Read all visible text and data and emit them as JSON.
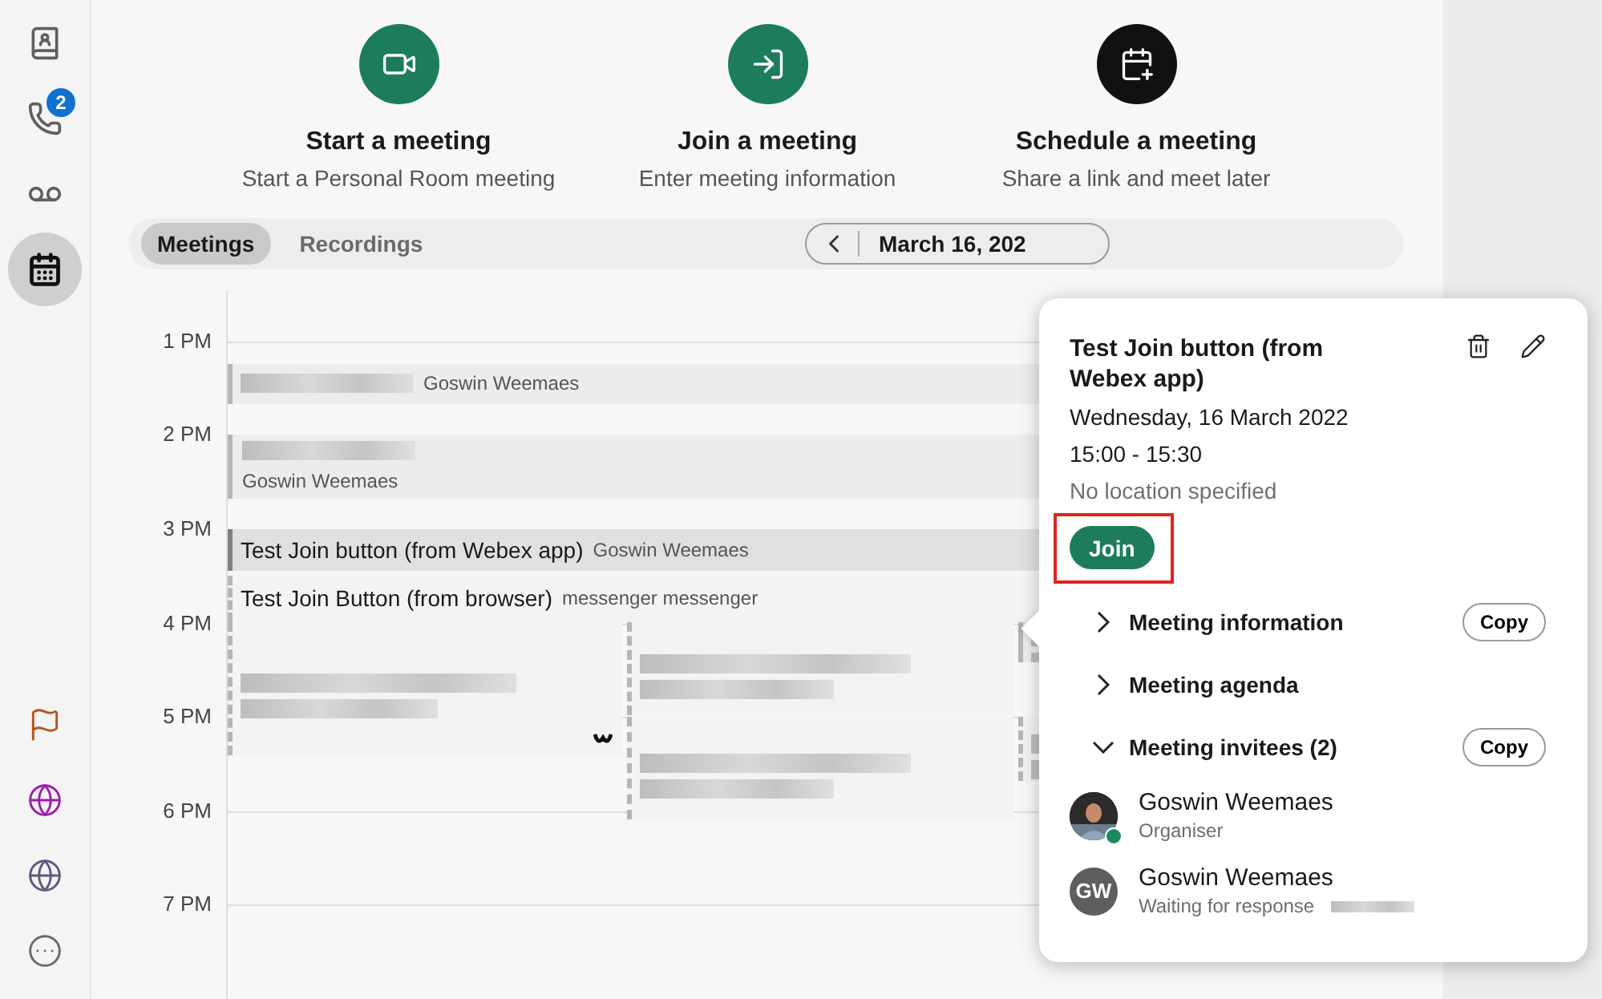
{
  "nav": {
    "items": [
      {
        "kind": "contacts",
        "selected": false
      },
      {
        "kind": "calls",
        "selected": false,
        "badge": "2"
      },
      {
        "kind": "voicemail",
        "selected": false
      },
      {
        "kind": "calendar",
        "selected": true
      }
    ],
    "bottom_items": [
      {
        "kind": "flag",
        "color": "#b4531f"
      },
      {
        "kind": "globe",
        "color": "#a11caf"
      },
      {
        "kind": "globe",
        "color": "#5b5b7d"
      },
      {
        "kind": "more",
        "color": "#6b6b6b"
      }
    ]
  },
  "actions": [
    {
      "kind": "start",
      "title": "Start a meeting",
      "subtitle": "Start a Personal Room meeting"
    },
    {
      "kind": "join",
      "title": "Join a meeting",
      "subtitle": "Enter meeting information"
    },
    {
      "kind": "schedule",
      "title": "Schedule a meeting",
      "subtitle": "Share a link and meet later"
    }
  ],
  "tabs": [
    {
      "label": "Meetings",
      "selected": true
    },
    {
      "label": "Recordings",
      "selected": false
    }
  ],
  "date_nav": {
    "date": "March 16, 202"
  },
  "calendar": {
    "hours": [
      "1 PM",
      "2 PM",
      "3 PM",
      "4 PM",
      "5 PM",
      "6 PM",
      "7 PM"
    ],
    "events": [
      {
        "kind": "inline",
        "title_redacted": true,
        "organizer": "Goswin Weemaes",
        "selected": false
      },
      {
        "kind": "stacked",
        "title_redacted": true,
        "organizer": "Goswin Weemaes",
        "selected": false
      },
      {
        "kind": "inline",
        "title": "Test Join button (from Webex app)",
        "organizer": "Goswin Weemaes",
        "selected": true
      },
      {
        "kind": "inline",
        "title": "Test Join Button (from browser)",
        "organizer": "messenger messenger",
        "selected": false,
        "tentative": true
      },
      {
        "kind": "block",
        "tentative": true,
        "webex": true
      },
      {
        "kind": "block",
        "tentative": true
      },
      {
        "kind": "block",
        "tentative": true
      },
      {
        "kind": "block",
        "tentative": false
      },
      {
        "kind": "block",
        "tentative": true
      }
    ]
  },
  "popover": {
    "title": "Test Join button (from Webex app)",
    "date": "Wednesday, 16 March 2022",
    "time": "15:00 - 15:30",
    "location": "No location specified",
    "join": {
      "label": "Join",
      "highlighted": true
    },
    "sections": [
      {
        "label": "Meeting information",
        "expanded": false,
        "copy": "Copy"
      },
      {
        "label": "Meeting agenda",
        "expanded": false
      },
      {
        "label": "Meeting invitees (2)",
        "expanded": true,
        "copy": "Copy"
      }
    ],
    "invitees": [
      {
        "name": "Goswin Weemaes",
        "status": "Organiser",
        "online": true
      },
      {
        "name": "Goswin Weemaes",
        "status": "Waiting for response",
        "kind": "initials",
        "initials": "GW",
        "online": false,
        "status_redacted": true
      }
    ]
  }
}
